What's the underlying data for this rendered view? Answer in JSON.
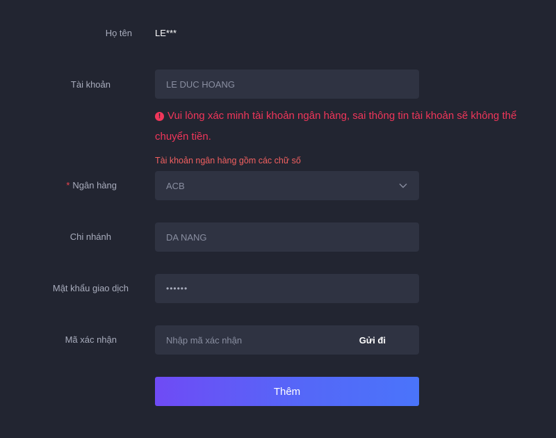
{
  "form": {
    "fullname": {
      "label": "Họ tên",
      "value": "LE***"
    },
    "account": {
      "label": "Tài khoản",
      "value": "LE DUC HOANG"
    },
    "warning": {
      "text": "Vui lòng xác minh tài khoản ngân hàng, sai thông tin tài khoản sẽ không thể chuyển tiền.",
      "icon": "exclamation-circle-icon"
    },
    "hint": "Tài khoản ngân hàng gồm các chữ số",
    "bank": {
      "required_mark": "*",
      "label": "Ngân hàng",
      "value": "ACB"
    },
    "branch": {
      "label": "Chi nhánh",
      "value": "DA NANG"
    },
    "tx_password": {
      "label": "Mật khẩu giao dịch",
      "value": "••••••"
    },
    "verify_code": {
      "label": "Mã xác nhận",
      "placeholder": "Nhập mã xác nhận",
      "send_label": "Gửi đi"
    },
    "submit_label": "Thêm"
  },
  "colors": {
    "background": "#222531",
    "field_bg": "#2f3342",
    "error": "#f0365a",
    "button_gradient_start": "#6f4bf5",
    "button_gradient_end": "#4a74fa"
  }
}
